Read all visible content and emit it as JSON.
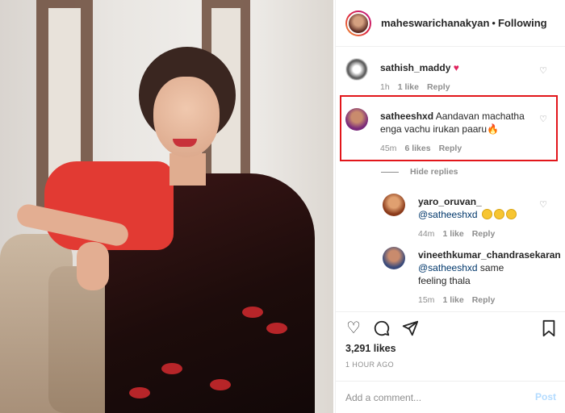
{
  "post": {
    "username": "maheswarichanakyan",
    "separator": "•",
    "follow_status": "Following"
  },
  "comments": [
    {
      "username": "sathish_maddy",
      "text": "",
      "emoji": "heart",
      "time": "1h",
      "likes": "1 like",
      "reply": "Reply"
    },
    {
      "username": "satheeshxd",
      "text": "Aandavan machatha enga vachu irukan paaru",
      "emoji": "fire",
      "time": "45m",
      "likes": "6 likes",
      "reply": "Reply"
    }
  ],
  "hide_replies_label": "Hide replies",
  "replies": [
    {
      "username": "yaro_oruvan_",
      "mention": "@satheeshxd",
      "text": "",
      "emoji": "grinning-sweat x3",
      "time": "44m",
      "likes": "1 like",
      "reply": "Reply"
    },
    {
      "username": "vineethkumar_chandrasekaran",
      "mention": "@satheeshxd",
      "text": "same feeling thala",
      "time": "15m",
      "likes": "1 like",
      "reply": "Reply"
    }
  ],
  "likes_count": "3,291 likes",
  "posted_time": "1 HOUR AGO",
  "comment_box": {
    "placeholder": "Add a comment...",
    "post_label": "Post"
  },
  "colors": {
    "highlight": "#e2161b",
    "link": "#00376b",
    "post_disabled": "#b3dbff"
  }
}
